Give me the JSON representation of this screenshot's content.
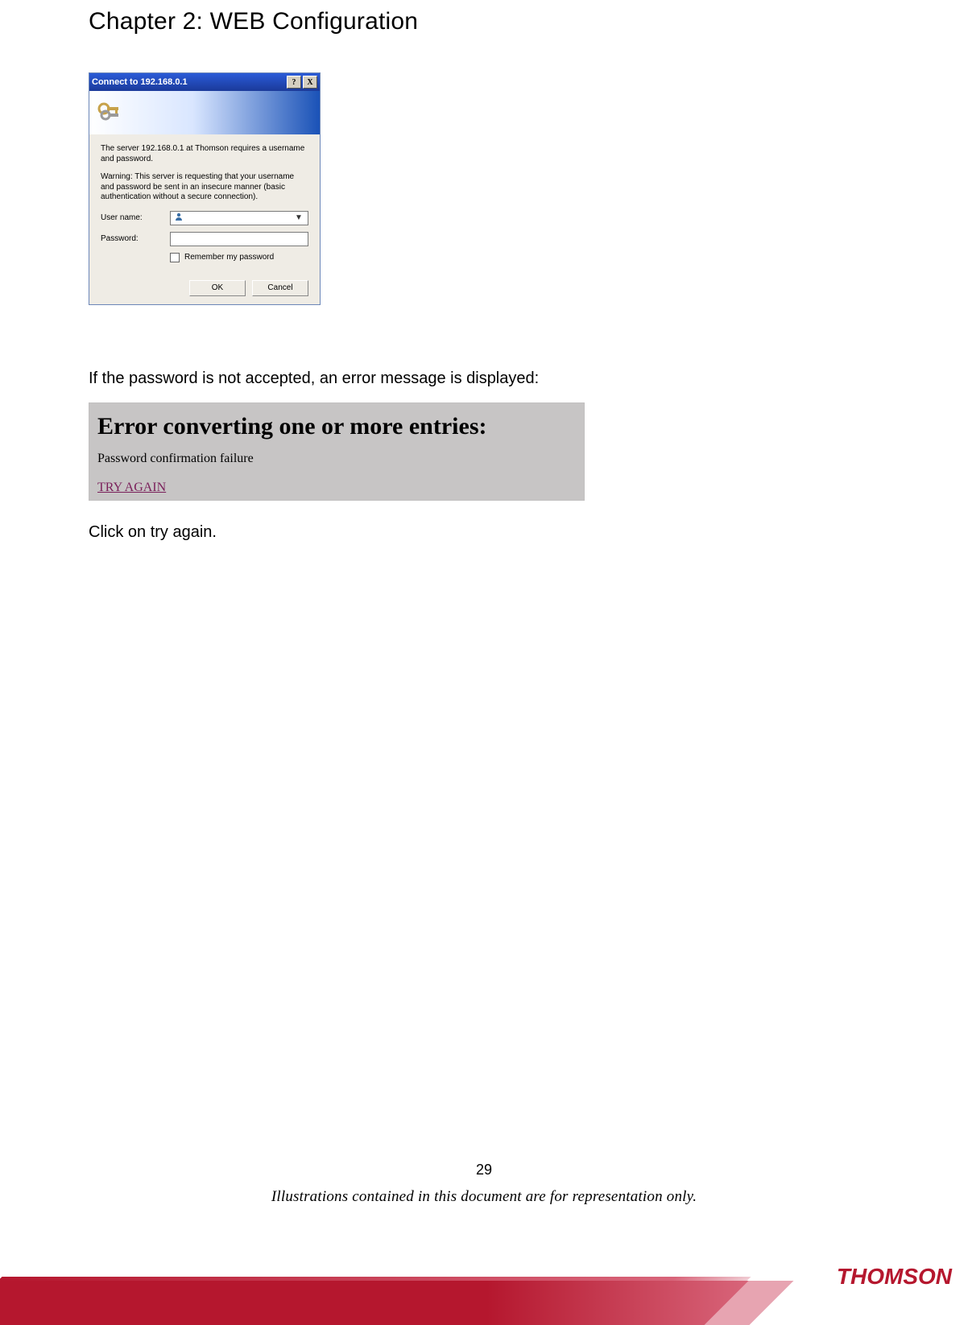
{
  "chapter": {
    "title": "Chapter 2: WEB Configuration"
  },
  "login_dialog": {
    "titlebar": "Connect to 192.168.0.1",
    "help_btn": "?",
    "close_btn": "X",
    "message1": "The server 192.168.0.1 at Thomson requires a username and password.",
    "message2": "Warning: This server is requesting that your username and password be sent in an insecure manner (basic authentication without a secure connection).",
    "username_label": "User name:",
    "password_label": "Password:",
    "remember_label": "Remember my password",
    "ok": "OK",
    "cancel": "Cancel"
  },
  "body_text": {
    "para1": "If the password is not accepted, an error message is displayed:",
    "para2": "Click on try again."
  },
  "error_box": {
    "title": "Error converting one or more entries:",
    "sub": "Password confirmation failure",
    "link": "TRY AGAIN"
  },
  "footer": {
    "page_num": "29",
    "disclaimer": "Illustrations contained in this document are for representation only.",
    "brand": "THOMSON"
  }
}
